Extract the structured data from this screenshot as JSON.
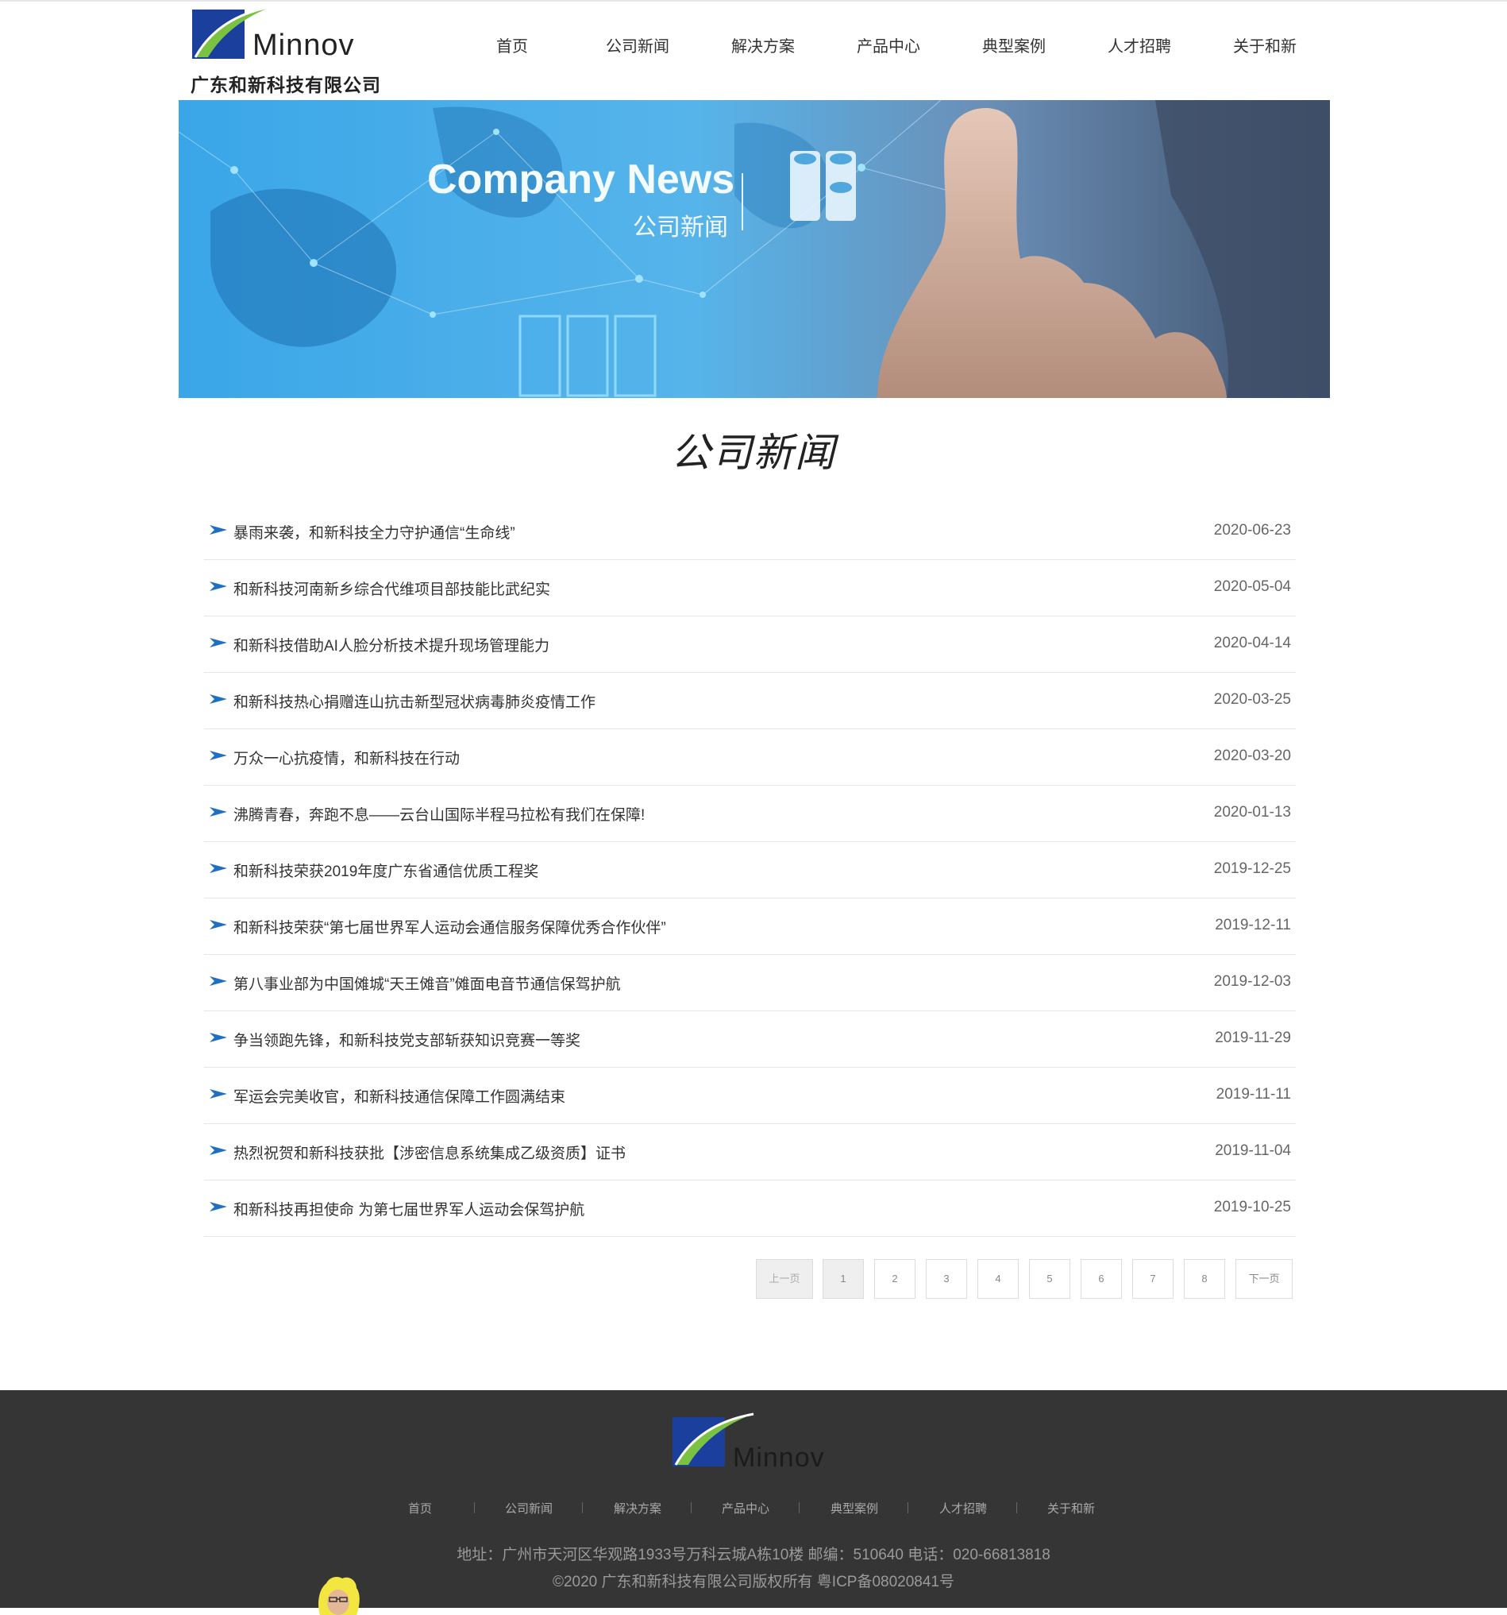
{
  "header": {
    "logo_word": "Minnov",
    "company_name": "广东和新科技有限公司",
    "nav": [
      "首页",
      "公司新闻",
      "解决方案",
      "产品中心",
      "典型案例",
      "人才招聘",
      "关于和新"
    ]
  },
  "banner": {
    "title_en": "Company News",
    "title_cn": "公司新闻"
  },
  "section_title": "公司新闻",
  "news": [
    {
      "title": "暴雨来袭，和新科技全力守护通信“生命线”",
      "date": "2020-06-23"
    },
    {
      "title": "和新科技河南新乡综合代维项目部技能比武纪实",
      "date": "2020-05-04"
    },
    {
      "title": "和新科技借助AI人脸分析技术提升现场管理能力",
      "date": "2020-04-14"
    },
    {
      "title": "和新科技热心捐赠连山抗击新型冠状病毒肺炎疫情工作",
      "date": "2020-03-25"
    },
    {
      "title": "万众一心抗疫情，和新科技在行动",
      "date": "2020-03-20"
    },
    {
      "title": "沸腾青春，奔跑不息——云台山国际半程马拉松有我们在保障!",
      "date": "2020-01-13"
    },
    {
      "title": "和新科技荣获2019年度广东省通信优质工程奖",
      "date": "2019-12-25"
    },
    {
      "title": "和新科技荣获“第七届世界军人运动会通信服务保障优秀合作伙伴”",
      "date": "2019-12-11"
    },
    {
      "title": "第八事业部为中国傩城“天王傩音”傩面电音节通信保驾护航",
      "date": "2019-12-03"
    },
    {
      "title": "争当领跑先锋，和新科技党支部斩获知识竞赛一等奖",
      "date": "2019-11-29"
    },
    {
      "title": "军运会完美收官，和新科技通信保障工作圆满结束",
      "date": "2019-11-11"
    },
    {
      "title": "热烈祝贺和新科技获批【涉密信息系统集成乙级资质】证书",
      "date": "2019-11-04"
    },
    {
      "title": "和新科技再担使命 为第七届世界军人运动会保驾护航",
      "date": "2019-10-25"
    }
  ],
  "pagination": {
    "prev": "上一页",
    "next": "下一页",
    "pages": [
      "1",
      "2",
      "3",
      "4",
      "5",
      "6",
      "7",
      "8"
    ],
    "current": "1"
  },
  "footer": {
    "logo_word": "Minnov",
    "nav": [
      "首页",
      "公司新闻",
      "解决方案",
      "产品中心",
      "典型案例",
      "人才招聘",
      "关于和新"
    ],
    "address": "地址：广州市天河区华观路1933号万科云城A栋10楼 邮编：510640 电话：020-66813818",
    "copyright": "©2020 广东和新科技有限公司版权所有   粤ICP备08020841号"
  },
  "colors": {
    "brand_blue": "#1a3f9c",
    "brand_green": "#7cc242",
    "footer_bg": "#353535",
    "arrow_blue": "#1f6fc2"
  }
}
